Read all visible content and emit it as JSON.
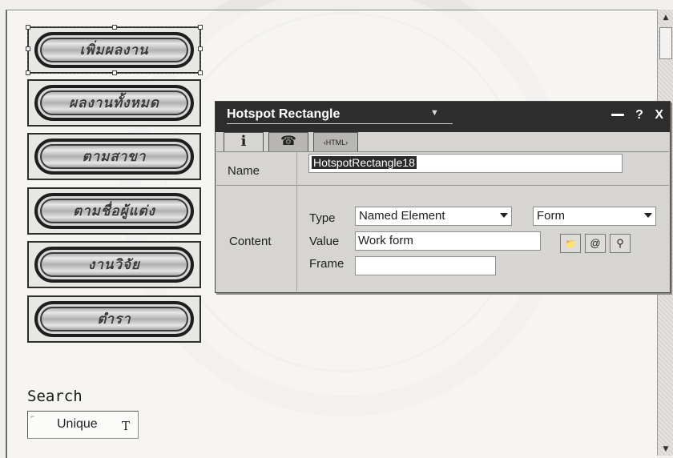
{
  "nav_buttons": [
    {
      "label": "เพิ่มผลงาน",
      "selected": true
    },
    {
      "label": "ผลงานทั้งหมด",
      "selected": false
    },
    {
      "label": "ตามสาขา",
      "selected": false
    },
    {
      "label": "ตามชื่อผู้แต่ง",
      "selected": false
    },
    {
      "label": "งานวิจัย",
      "selected": false
    },
    {
      "label": "ตำรา",
      "selected": false
    }
  ],
  "search": {
    "label": "Search",
    "field_value": "Unique",
    "type_glyph": "T"
  },
  "inspector": {
    "title": "Hotspot Rectangle",
    "tabs": [
      {
        "icon": "info-icon",
        "glyph": "i"
      },
      {
        "icon": "behaviors-icon",
        "glyph": "☎"
      },
      {
        "icon": "html-icon",
        "glyph": "‹HTML›"
      }
    ],
    "name_label": "Name",
    "name_value": "HotspotRectangle18",
    "content_label": "Content",
    "type_label": "Type",
    "type_value": "Named Element",
    "form_value": "Form",
    "value_label": "Value",
    "value_value": "Work form",
    "frame_label": "Frame",
    "frame_value": "",
    "help": "?",
    "close": "X",
    "folder_icon": "📁",
    "at_icon": "@",
    "link_icon": "⚲"
  }
}
